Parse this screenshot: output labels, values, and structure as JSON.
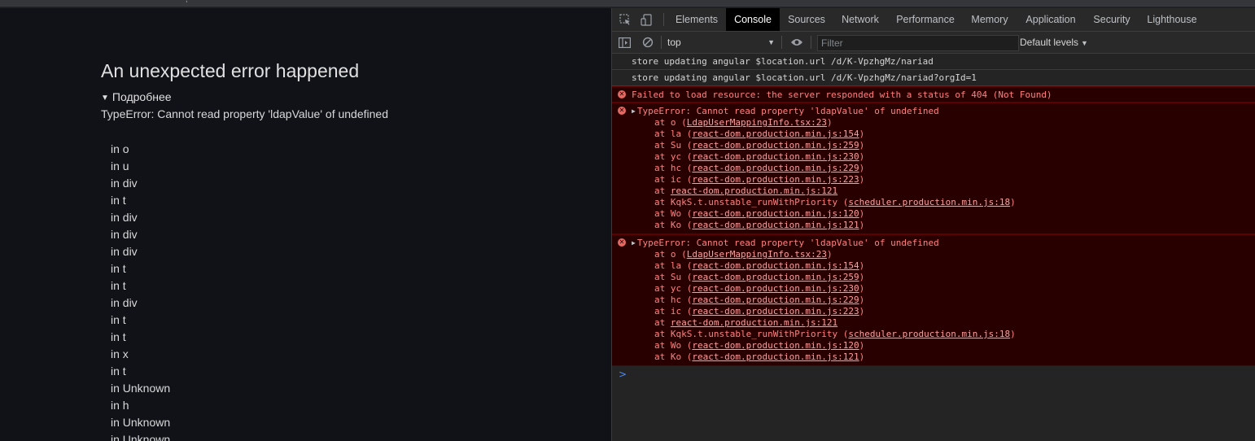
{
  "top_strip": {
    "glyph": ","
  },
  "page": {
    "error_title": "An unexpected error happened",
    "details_toggle": "Подробнее",
    "error_message": "TypeError: Cannot read property 'ldapValue' of undefined",
    "component_stack": [
      "in o",
      "in u",
      "in div",
      "in t",
      "in div",
      "in div",
      "in div",
      "in t",
      "in t",
      "in div",
      "in t",
      "in t",
      "in x",
      "in t",
      "in Unknown",
      "in h",
      "in Unknown",
      "in Unknown"
    ]
  },
  "devtools": {
    "tabs": [
      "Elements",
      "Console",
      "Sources",
      "Network",
      "Performance",
      "Memory",
      "Application",
      "Security",
      "Lighthouse"
    ],
    "active_tab": "Console",
    "toolbar": {
      "context": "top",
      "filter_placeholder": "Filter",
      "levels": "Default levels"
    },
    "icons": {
      "inspect": "inspect-element-icon",
      "device": "device-toolbar-icon",
      "sidebar": "console-sidebar-icon",
      "clear": "clear-console-icon",
      "eye": "live-expression-eye-icon"
    },
    "colors": {
      "error_bg": "#290000",
      "error_text": "#ff8080",
      "active_tab_bg": "#000000"
    },
    "console": {
      "logs": [
        "store updating angular $location.url /d/K-VpzhgMz/nariad",
        "store updating angular $location.url /d/K-VpzhgMz/nariad?orgId=1"
      ],
      "resource_error": "Failed to load resource: the server responded with a status of 404 (Not Found)",
      "errors": [
        {
          "head": "TypeError: Cannot read property 'ldapValue' of undefined",
          "frames": [
            {
              "pre": "at o (",
              "link": "LdapUserMappingInfo.tsx:23",
              "post": ")"
            },
            {
              "pre": "at la (",
              "link": "react-dom.production.min.js:154",
              "post": ")"
            },
            {
              "pre": "at Su (",
              "link": "react-dom.production.min.js:259",
              "post": ")"
            },
            {
              "pre": "at yc (",
              "link": "react-dom.production.min.js:230",
              "post": ")"
            },
            {
              "pre": "at hc (",
              "link": "react-dom.production.min.js:229",
              "post": ")"
            },
            {
              "pre": "at ic (",
              "link": "react-dom.production.min.js:223",
              "post": ")"
            },
            {
              "pre": "at ",
              "link": "react-dom.production.min.js:121",
              "post": ""
            },
            {
              "pre": "at KqkS.t.unstable_runWithPriority (",
              "link": "scheduler.production.min.js:18",
              "post": ")"
            },
            {
              "pre": "at Wo (",
              "link": "react-dom.production.min.js:120",
              "post": ")"
            },
            {
              "pre": "at Ko (",
              "link": "react-dom.production.min.js:121",
              "post": ")"
            }
          ]
        },
        {
          "head": "TypeError: Cannot read property 'ldapValue' of undefined",
          "frames": [
            {
              "pre": "at o (",
              "link": "LdapUserMappingInfo.tsx:23",
              "post": ")"
            },
            {
              "pre": "at la (",
              "link": "react-dom.production.min.js:154",
              "post": ")"
            },
            {
              "pre": "at Su (",
              "link": "react-dom.production.min.js:259",
              "post": ")"
            },
            {
              "pre": "at yc (",
              "link": "react-dom.production.min.js:230",
              "post": ")"
            },
            {
              "pre": "at hc (",
              "link": "react-dom.production.min.js:229",
              "post": ")"
            },
            {
              "pre": "at ic (",
              "link": "react-dom.production.min.js:223",
              "post": ")"
            },
            {
              "pre": "at ",
              "link": "react-dom.production.min.js:121",
              "post": ""
            },
            {
              "pre": "at KqkS.t.unstable_runWithPriority (",
              "link": "scheduler.production.min.js:18",
              "post": ")"
            },
            {
              "pre": "at Wo (",
              "link": "react-dom.production.min.js:120",
              "post": ")"
            },
            {
              "pre": "at Ko (",
              "link": "react-dom.production.min.js:121",
              "post": ")"
            }
          ]
        }
      ],
      "prompt": ">"
    }
  }
}
